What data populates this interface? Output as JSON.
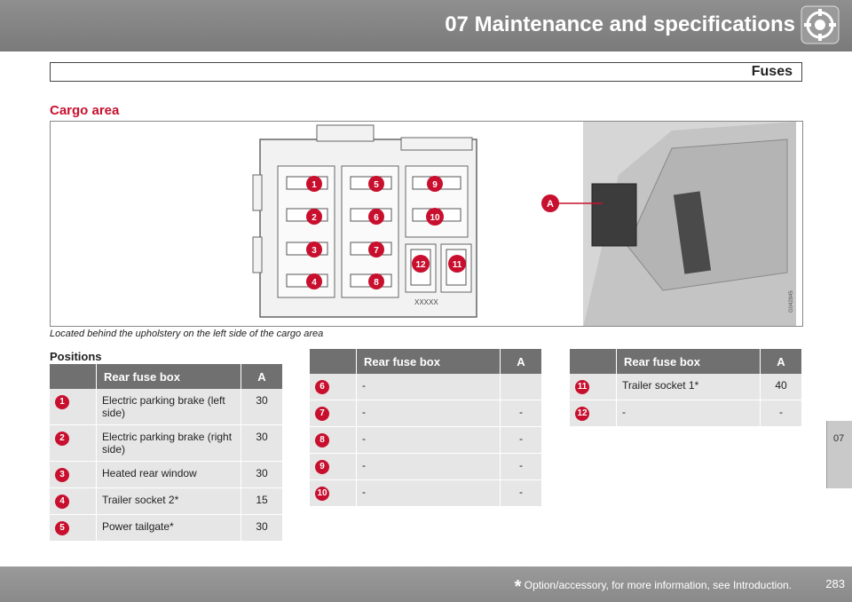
{
  "header": {
    "title": "07 Maintenance and specifications",
    "icon": "wrench-gear-icon"
  },
  "section": {
    "title": "Fuses"
  },
  "cargo": {
    "title": "Cargo area",
    "caption": "Located behind the upholstery on the left side of the cargo area",
    "figure_labels": [
      "1",
      "2",
      "3",
      "4",
      "5",
      "6",
      "7",
      "8",
      "9",
      "10",
      "12",
      "11"
    ],
    "callout": "A",
    "figure_code": "G042845",
    "connector_text": "XXXXX"
  },
  "positions_label": "Positions",
  "tables": [
    {
      "header_name": "Rear fuse box",
      "header_amp": "A",
      "rows": [
        {
          "num": "1",
          "name": "Electric parking brake (left side)",
          "amp": "30"
        },
        {
          "num": "2",
          "name": "Electric parking brake (right side)",
          "amp": "30"
        },
        {
          "num": "3",
          "name": "Heated rear window",
          "amp": "30"
        },
        {
          "num": "4",
          "name": "Trailer socket 2*",
          "amp": "15"
        },
        {
          "num": "5",
          "name": "Power tailgate*",
          "amp": "30"
        }
      ]
    },
    {
      "header_name": "Rear fuse box",
      "header_amp": "A",
      "rows": [
        {
          "num": "6",
          "name": "-",
          "amp": ""
        },
        {
          "num": "7",
          "name": "-",
          "amp": "-"
        },
        {
          "num": "8",
          "name": "-",
          "amp": "-"
        },
        {
          "num": "9",
          "name": "-",
          "amp": "-"
        },
        {
          "num": "10",
          "name": "-",
          "amp": "-"
        }
      ]
    },
    {
      "header_name": "Rear fuse box",
      "header_amp": "A",
      "rows": [
        {
          "num": "11",
          "name": "Trailer socket 1*",
          "amp": "40"
        },
        {
          "num": "12",
          "name": "-",
          "amp": "-"
        }
      ]
    }
  ],
  "side_tab": "07",
  "footer": {
    "star": "*",
    "note": "Option/accessory, for more information, see Introduction.",
    "page": "283"
  },
  "colors": {
    "accent": "#c8102e",
    "header_bg": "#7f7f7f",
    "table_header": "#707070",
    "row_bg": "#e6e6e6"
  }
}
